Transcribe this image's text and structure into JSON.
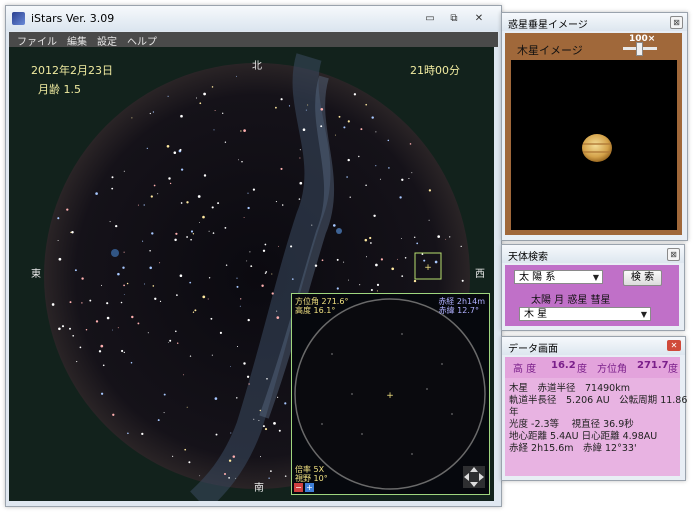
{
  "app": {
    "title": "iStars  Ver. 3.09"
  },
  "window_controls": {
    "minimize": "▭",
    "restore": "⧉",
    "close": "✕"
  },
  "menu": {
    "items": [
      "ファイル",
      "編集",
      "設定",
      "ヘルプ"
    ]
  },
  "sky": {
    "date": "2012年2月23日",
    "time": "21時00分",
    "moon_age": "月齢 1.5",
    "directions": {
      "north": "北",
      "south": "南",
      "east": "東",
      "west": "西"
    }
  },
  "zoom_panel": {
    "azimuth": "方位角 271.6°",
    "altitude": "高度 16.1°",
    "ra": "赤経 2h14m",
    "dec": "赤緯 12.7°",
    "magnification": "倍率 5X",
    "field": "視野 10°",
    "minus": "−",
    "plus": "+"
  },
  "planet_window": {
    "title": "惑星垂星イメージ",
    "label": "木星イメージ",
    "zoom": "100×",
    "close": "⊠"
  },
  "search_window": {
    "title": "天体検索",
    "category": "太 陽 系",
    "search_button": "検 索",
    "subtitle": "太陽 月 惑星 彗星",
    "target": "木 星",
    "close": "⊠"
  },
  "data_window": {
    "title": "データ画面",
    "altitude_label": "高 度",
    "altitude_value": "16.2",
    "altitude_unit": "度",
    "azimuth_label": "方位角",
    "azimuth_value": "271.7",
    "azimuth_unit": "度",
    "lines": [
      "木星　赤道半径　71490km",
      "軌道半長径　5.206 AU　公転周期 11.86",
      "年",
      "光度 -2.3等　 視直径 36.9秒",
      "地心距離 5.4AU  日心距離 4.98AU",
      "赤経 2h15.6m　赤緯 12°33'"
    ],
    "close": "✕"
  },
  "colors": {
    "accent_purple": "#c070c8",
    "planet_bg": "#a0683a",
    "data_bg": "#e3a3dc",
    "sky_bg": "#12221c"
  }
}
